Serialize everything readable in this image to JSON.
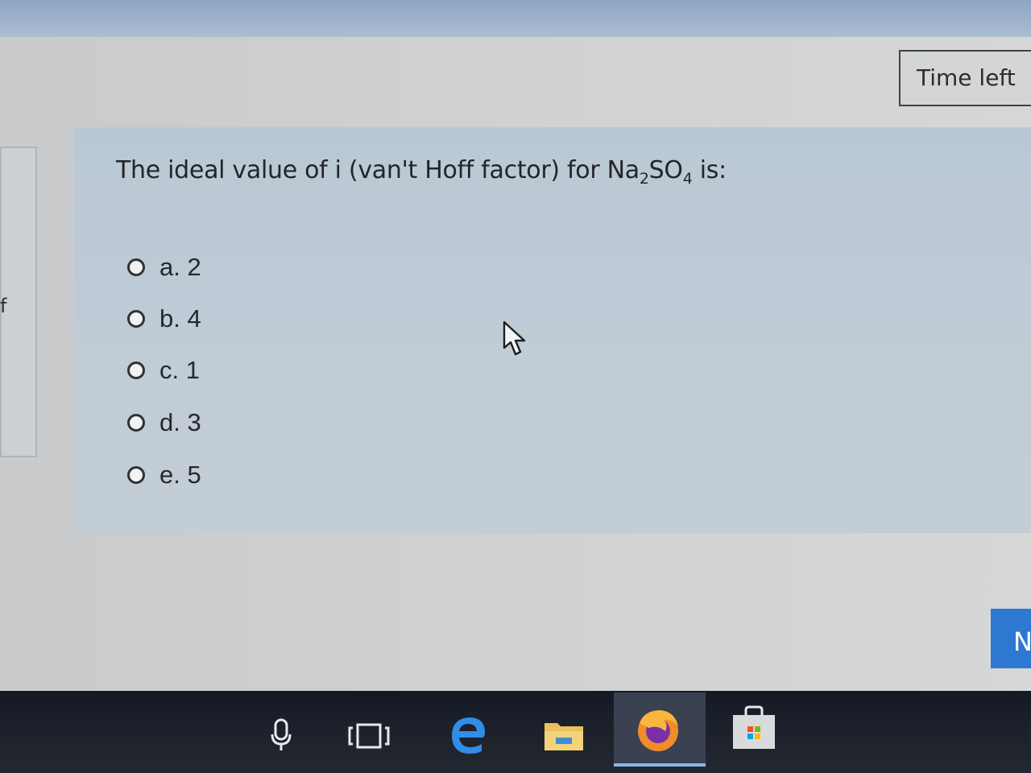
{
  "timer": {
    "label": "Time left"
  },
  "nav": {
    "partial_letter": "f"
  },
  "question": {
    "prefix": "The ideal value of i (van't Hoff factor) for Na",
    "sub1": "2",
    "mid": "SO",
    "sub2": "4",
    "suffix": " is:"
  },
  "answers": [
    {
      "label": "a. 2"
    },
    {
      "label": "b. 4"
    },
    {
      "label": "c. 1"
    },
    {
      "label": "d. 3"
    },
    {
      "label": "e. 5"
    }
  ],
  "next_button": {
    "label": "N"
  },
  "taskbar": {
    "icons": [
      "microphone-icon",
      "task-view-icon",
      "edge-icon",
      "file-explorer-icon",
      "firefox-icon",
      "store-icon"
    ]
  },
  "colors": {
    "next_button": "#2e78d2",
    "taskbar": "#1b202a",
    "card": "#bfcbd6"
  }
}
